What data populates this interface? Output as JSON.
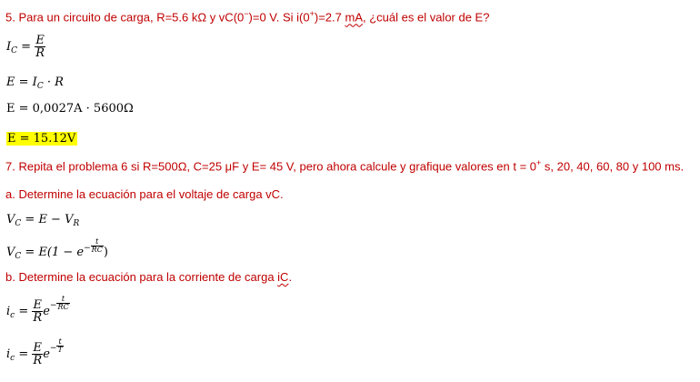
{
  "problem5": {
    "pre": "5. Para un circuito de carga, R=5.6 kΩ y vC(0",
    "sup1": "−",
    "mid": ")=0 V. Si i(0",
    "sup2": "+",
    "mid2": ")=2.7 ",
    "unit": "mA",
    "post": ", ¿cuál es el valor de E?"
  },
  "eq_ic": {
    "lhs": "I",
    "sub": "C",
    "eq": " = ",
    "num": "E",
    "den": "R"
  },
  "eq_e1": {
    "lhs": "E",
    "eq": " = ",
    "rhs": "I",
    "sub": "C",
    "dot": " · R"
  },
  "eq_e2": {
    "text": "E = 0,0027A · 5600Ω"
  },
  "eq_result": {
    "text": "E = 15.12V"
  },
  "problem7": {
    "pre": "7. Repita el problema 6 si R=500Ω, C=25 μF y E= 45 V, pero ahora calcule y grafique valores en t = 0",
    "sup": "+",
    "post": " s, 20, 40, 60, 80 y 100 ms."
  },
  "part_a": "a. Determine la ecuación para el voltaje de carga vC.",
  "eq_vc1": {
    "lhs": "V",
    "sub": "C",
    "eq": " = E − V",
    "sub2": "R"
  },
  "eq_vc2": {
    "lhs": "V",
    "sub": "C",
    "pre": " = E(1 − e",
    "minus": "−",
    "num": "t",
    "den": "RC",
    "post": ")"
  },
  "part_b": {
    "pre": "b. Determine la ecuación para la corriente de carga ",
    "word": "iC",
    "post": "."
  },
  "eq_ic1": {
    "lhs": "i",
    "sub": "c",
    "eq": " = ",
    "num": "E",
    "den": "R",
    "e": "e",
    "minus": "−",
    "snum": "t",
    "sden": "RC"
  },
  "eq_ic2": {
    "lhs": "i",
    "sub": "c",
    "eq": " = ",
    "num": "E",
    "den": "R",
    "e": "e",
    "minus": "−",
    "snum": "t",
    "sden": "T"
  }
}
